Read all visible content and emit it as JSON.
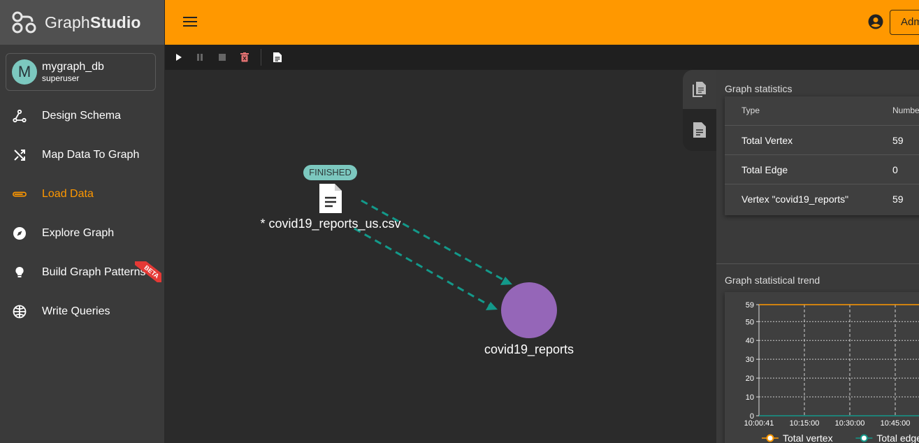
{
  "brand": {
    "name_part1": "Graph",
    "name_part2": "Studio"
  },
  "account": {
    "initial": "M",
    "name": "mygraph_db",
    "role": "superuser"
  },
  "nav": {
    "items": [
      {
        "label": "Design Schema",
        "icon": "schema-icon"
      },
      {
        "label": "Map Data To Graph",
        "icon": "shuffle-icon"
      },
      {
        "label": "Load Data",
        "icon": "load-data-icon",
        "active": true
      },
      {
        "label": "Explore Graph",
        "icon": "compass-icon"
      },
      {
        "label": "Build Graph Patterns",
        "icon": "lightbulb-icon",
        "badge": "BETA"
      },
      {
        "label": "Write Queries",
        "icon": "globe-icon"
      }
    ]
  },
  "header": {
    "admin_label": "Admin"
  },
  "canvas": {
    "file_node": {
      "status": "FINISHED",
      "label": "* covid19_reports_us.csv"
    },
    "vertex": {
      "label": "covid19_reports",
      "color": "#9566b8"
    },
    "edge_color": "#13998a"
  },
  "stats": {
    "title": "Graph statistics",
    "col_type": "Type",
    "col_number": "Number",
    "rows": [
      {
        "type": "Total Vertex",
        "number": "59"
      },
      {
        "type": "Total Edge",
        "number": "0"
      },
      {
        "type": "Vertex \"covid19_reports\"",
        "number": "59"
      }
    ]
  },
  "trend": {
    "title": "Graph statistical trend"
  },
  "chart_data": {
    "type": "line",
    "x": [
      "10:00:41",
      "10:15:00",
      "10:30:00",
      "10:45:00"
    ],
    "series": [
      {
        "name": "Total vertex",
        "values": [
          59,
          59,
          59,
          59
        ],
        "color": "#ff9800"
      },
      {
        "name": "Total edge",
        "values": [
          0,
          0,
          0,
          0
        ],
        "color": "#13998a"
      }
    ],
    "y_ticks": [
      0,
      10,
      20,
      30,
      40,
      50,
      59
    ],
    "ylim": [
      0,
      59
    ],
    "grid": true,
    "legend": "bottom"
  }
}
